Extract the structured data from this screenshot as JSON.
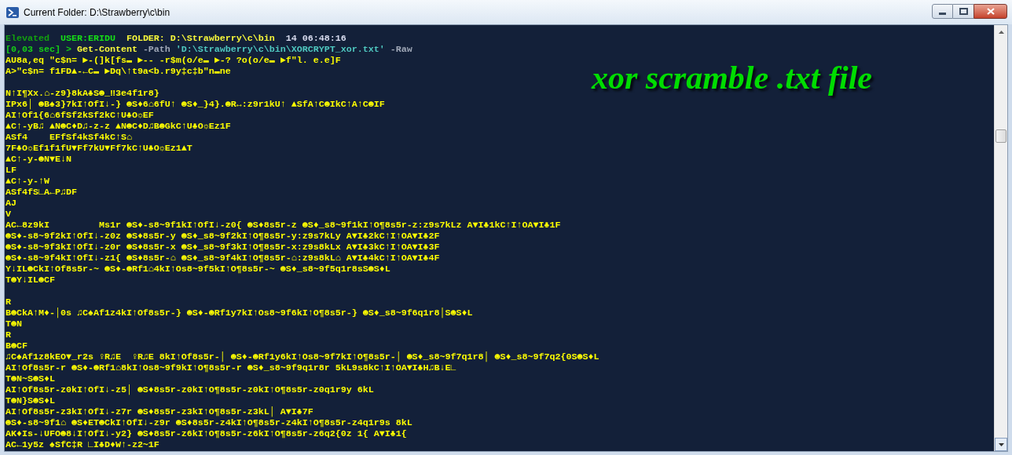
{
  "window": {
    "title": "Current Folder: D:\\Strawberry\\c\\bin"
  },
  "console": {
    "lines": [
      {
        "kind": "status",
        "segments": [
          {
            "kind": "elevated",
            "text": "Elevated"
          },
          {
            "kind": "user",
            "text": "USER:ERIDU"
          },
          {
            "kind": "folder",
            "text": "FOLDER: D:\\Strawberry\\c\\bin"
          },
          {
            "kind": "time",
            "text": "14 06:48:16"
          }
        ]
      },
      {
        "kind": "command",
        "segments": [
          {
            "kind": "prompt",
            "text": "[0,03 sec] >"
          },
          {
            "kind": "cmdlet",
            "text": "Get-Content"
          },
          {
            "kind": "parameter",
            "text": "-Path"
          },
          {
            "kind": "string",
            "text": "'D:\\Strawberry\\c\\bin\\XORCRYPT_xor.txt'"
          },
          {
            "kind": "parameter",
            "text": "-Raw"
          }
        ]
      },
      {
        "kind": "output",
        "text": "AU8a,eq \"c$n= ►-(]k[fs▬ ►-- -r$m(o/e▬ ►-? ?o(o/e▬ ►f\"l. e.e]F"
      },
      {
        "kind": "output",
        "text": "A>\"c$n= f1FD▲-←C▬ ►Dq\\↑t9a<b.r9y‡c‡b\"n▬ne"
      },
      {
        "kind": "blank"
      },
      {
        "kind": "output",
        "text": "N↑I¶Xx.⌂-z9}8kA♣S☻_‼3e4f1r8}"
      },
      {
        "kind": "output",
        "text": "IPx6│ ☻B♠3}7kI↑OfI↓-} ☻S♦6⌂6fU↑ ☻S♦_}4}.☻R↔:z9r1kU↑ ▲SfA↑C☻IkC↑A↑C☻IF"
      },
      {
        "kind": "output",
        "text": "AI↑Of1{6⌂6fSf2kSf2kC↑U♣O☼EF"
      },
      {
        "kind": "output",
        "text": "▲C↑-yB♫ ▲N☻C♦D♫-z-z ▲N☻C♦D♫B☻GkC↑U♣O☼Ez1F"
      },
      {
        "kind": "output",
        "text": "ASf4    EFfSf4kSf4kC↑S⌂"
      },
      {
        "kind": "output",
        "text": "7F♣O☼Ef1f1fU▼Ff7kU▼Ff7kC↑U♣O☼Ez1▲T"
      },
      {
        "kind": "output",
        "text": "▲C↑-y-☻N▼E↓N"
      },
      {
        "kind": "output",
        "text": "LF"
      },
      {
        "kind": "output",
        "text": "▲C↑-y-↑W"
      },
      {
        "kind": "output",
        "text": "ASf4fS∟A←P♫DF"
      },
      {
        "kind": "output",
        "text": "AJ"
      },
      {
        "kind": "output",
        "text": "V"
      },
      {
        "kind": "output",
        "text": "AC←8z9kI         Ms1r ☻S♦-s8~9f1kI↑OfI↓-z0{ ☻S♦8s5r-z ☻S♦_s8~9f1kI↑O¶8s5r-z:z9s7kLz A▼I♣1kC↑I↑OA▼I♣1F"
      },
      {
        "kind": "output",
        "text": "☻S♦-s8~9f2kI↑OfI↓-z0z ☻S♦8s5r-y ☻S♦_s8~9f2kI↑O¶8s5r-y:z9s7kLy A▼I♣2kC↑I↑OA▼I♣2F"
      },
      {
        "kind": "output",
        "text": "☻S♦-s8~9f3kI↑OfI↓-z0r ☻S♦8s5r-x ☻S♦_s8~9f3kI↑O¶8s5r-x:z9s8kLx A▼I♣3kC↑I↑OA▼I♣3F"
      },
      {
        "kind": "output",
        "text": "☻S♦-s8~9f4kI↑OfI↓-z1{ ☻S♦8s5r-⌂ ☻S♦_s8~9f4kI↑O¶8s5r-⌂:z9s8kL⌂ A▼I♣4kC↑I↑OA▼I♣4F"
      },
      {
        "kind": "output",
        "text": "Y↓IL☻CkI↑Of8s5r-~ ☻S♦-☻Rf1⌂4kI↑Os8~9f5kI↑O¶8s5r-~ ☻S♦_s8~9f5q1r8sS☻S♦L"
      },
      {
        "kind": "output",
        "text": "T☻Y↓IL☻CF"
      },
      {
        "kind": "blank"
      },
      {
        "kind": "output",
        "text": "R"
      },
      {
        "kind": "output",
        "text": "B☻CkA↑M♦-│0s ♫C♠Af1z4kI↑Of8s5r-} ☻S♦-☻Rf1y7kI↑Os8~9f6kI↑O¶8s5r-} ☻S♦_s8~9f6q1r8│S☻S♦L"
      },
      {
        "kind": "output",
        "text": "T☻N"
      },
      {
        "kind": "output",
        "text": "R"
      },
      {
        "kind": "output",
        "text": "B☻CF"
      },
      {
        "kind": "output",
        "text": "♫C♠Af1z8kEO▼_r2s ♀R♫E  ♀R♫E 8kI↑Of8s5r-│ ☻S♦-☻Rf1y6kI↑Os8~9f7kI↑O¶8s5r-│ ☻S♦_s8~9f7q1r8│ ☻S♦_s8~9f7q2{0S☻S♦L"
      },
      {
        "kind": "output",
        "text": "AI↑Of8s5r-r ☻S♦-☻Rf1⌂8kI↑Os8~9f9kI↑O¶8s5r-r ☻S♦_s8~9f9q1r8r 5kL9s8kC↑I↑OA▼I♣H♫B↓E∟"
      },
      {
        "kind": "output",
        "text": "T☻N~S☻S♦L"
      },
      {
        "kind": "output",
        "text": "AI↑Of8s5r-z0kI↑OfI↓-z5│ ☻S♦8s5r-z0kI↑O¶8s5r-z0kI↑O¶8s5r-z0q1r9y 6kL"
      },
      {
        "kind": "output",
        "text": "T☻N}S☻S♦L"
      },
      {
        "kind": "output",
        "text": "AI↑Of8s5r-z3kI↑OfI↓-z7r ☻S♦8s5r-z3kI↑O¶8s5r-z3kL│ A▼I♣7F"
      },
      {
        "kind": "output",
        "text": "☻S♦-s8~9f1⌂ ☻S♦ET☻CkI↑OfI↓-z9r ☻S♦8s5r-z4kI↑O¶8s5r-z4kI↑O¶8s5r-z4q1r9s 8kL"
      },
      {
        "kind": "output",
        "text": "AK♦Is-↓UFO☻8↓I↑OfI↓-y2} ☻S♦8s5r-z6kI↑O¶8s5r-z6kI↑O¶8s5r-z6q2{0z 1{ A▼I♣1{"
      },
      {
        "kind": "output",
        "text": "AC←1y5z ♠SfC‡R ∟I♣D♦W↑-z2~1F"
      }
    ]
  },
  "overlay": {
    "text": "xor scramble .txt file"
  }
}
